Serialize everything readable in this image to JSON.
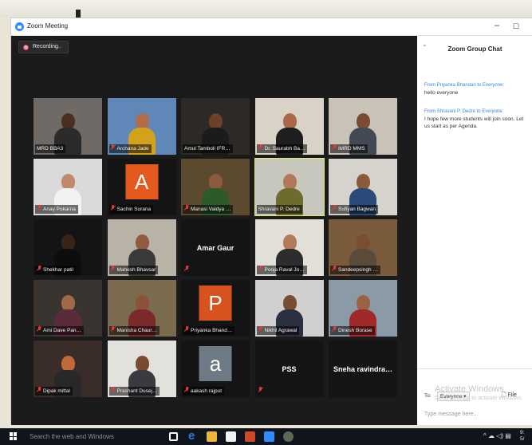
{
  "window": {
    "title": "Zoom Meeting",
    "minimize_glyph": "–",
    "maximize_glyph": "☐"
  },
  "recording": {
    "label": "Recording..",
    "icon": "record-icon"
  },
  "participants": [
    {
      "name": "MRD BBA3",
      "muted": false,
      "kind": "video",
      "bg": "#6f6a66",
      "skin": "#4a2e22",
      "shirt": "#2b2b2b"
    },
    {
      "name": "Archana Jade",
      "muted": true,
      "kind": "video",
      "bg": "#5f87b8",
      "skin": "#b06d4b",
      "shirt": "#d4a21a"
    },
    {
      "name": "Amul Tamboli IFR…",
      "muted": false,
      "kind": "video",
      "bg": "#2c2926",
      "skin": "#6b4228",
      "shirt": "#1b1b1b"
    },
    {
      "name": "Dr. Saurabh Ba…",
      "muted": true,
      "kind": "video",
      "bg": "#d8d2c7",
      "skin": "#a86a48",
      "shirt": "#1e1e1e"
    },
    {
      "name": "IMRD MMS",
      "muted": true,
      "kind": "video",
      "bg": "#c9c2b7",
      "skin": "#7a4c35",
      "shirt": "#444a55"
    },
    {
      "name": "Anay Pokarna",
      "muted": true,
      "kind": "video",
      "bg": "#d9d9d9",
      "skin": "#c08a6a",
      "shirt": "#f2f2f2"
    },
    {
      "name": "Sachin Surana",
      "muted": true,
      "kind": "avatar",
      "letter": "A",
      "color": "#e4591e"
    },
    {
      "name": "Manasi Vaidya …",
      "muted": true,
      "kind": "video",
      "bg": "#5b4a2e",
      "skin": "#8c5a3c",
      "shirt": "#2c5a2a"
    },
    {
      "name": "Shravani P. Dedre",
      "muted": false,
      "active": true,
      "kind": "video",
      "bg": "#c8c7bd",
      "skin": "#b07a5a",
      "shirt": "#6d6b2d"
    },
    {
      "name": "Sufiyan Bagwan",
      "muted": true,
      "kind": "video",
      "bg": "#d6d3cc",
      "skin": "#8a5a3a",
      "shirt": "#2a4a7a"
    },
    {
      "name": "Shekhar patil",
      "muted": true,
      "kind": "video",
      "bg": "#141414",
      "skin": "#3a2418",
      "shirt": "#0d0d0d"
    },
    {
      "name": "Mahesh Bhavsar",
      "muted": true,
      "kind": "video",
      "bg": "#b9b2a6",
      "skin": "#8e5c3e",
      "shirt": "#3a3a3a"
    },
    {
      "name": "",
      "muted": true,
      "kind": "name",
      "label": "Amar Gaur"
    },
    {
      "name": "Pooja Raval Jo…",
      "muted": true,
      "kind": "video",
      "bg": "#e1dfd8",
      "skin": "#b17a58",
      "shirt": "#2d2d2d"
    },
    {
      "name": "Sandeepsingh …",
      "muted": true,
      "kind": "video",
      "bg": "#7a5b3c",
      "skin": "#7a4e30",
      "shirt": "#5a4b3a"
    },
    {
      "name": "Ami Dave Pan…",
      "muted": true,
      "kind": "video",
      "bg": "#3a3431",
      "skin": "#a26948",
      "shirt": "#5a2c3a"
    },
    {
      "name": "Manisha Chaur…",
      "muted": true,
      "kind": "video",
      "bg": "#7a6a4e",
      "skin": "#8a5236",
      "shirt": "#7a2a2a"
    },
    {
      "name": "Priyanka Bhand…",
      "muted": true,
      "kind": "avatar",
      "letter": "P",
      "color": "#d9531e"
    },
    {
      "name": "Nikhil Agrawal",
      "muted": true,
      "kind": "video",
      "bg": "#cfd0cf",
      "skin": "#7a4c32",
      "shirt": "#2a3040"
    },
    {
      "name": "Dinesh Borase",
      "muted": true,
      "kind": "video",
      "bg": "#8a9aa6",
      "skin": "#9a6444",
      "shirt": "#a02a2a"
    },
    {
      "name": "Dipak mittal",
      "muted": true,
      "kind": "video",
      "bg": "#3a2c28",
      "skin": "#c06a3a",
      "shirt": "#282828"
    },
    {
      "name": "Prashant Dusej…",
      "muted": true,
      "kind": "video",
      "bg": "#e3e1dc",
      "skin": "#7a4a30",
      "shirt": "#3a3a40"
    },
    {
      "name": "aakash rajput",
      "muted": true,
      "kind": "avatar",
      "letter": "a",
      "color": "#6e7a85"
    },
    {
      "name": "",
      "muted": true,
      "kind": "name",
      "label": "PSS"
    },
    {
      "name": "",
      "muted": false,
      "kind": "name",
      "label": "Sneha  ravindra…"
    }
  ],
  "chat": {
    "title": "Zoom Group Chat",
    "collapse_glyph": "⌄",
    "messages": [
      {
        "from": "Priyanka Bhandari",
        "to": "Everyone",
        "text": "hello everyone"
      },
      {
        "from": "Shravani P. Dedre",
        "to": "Everyone",
        "text": "I hope few more students will join soon. Let us start as per Agenda."
      }
    ],
    "from_word": "From",
    "to_word": "to",
    "to_label": "To:",
    "to_value": "Everyone ▾",
    "file_label": "File",
    "input_placeholder": "Type message here..."
  },
  "watermark": {
    "line1": "Activate Windows",
    "line2": "Go to Settings to activate Windows."
  },
  "taskbar": {
    "search_placeholder": "Search the web and Windows",
    "tray_text": "^ ☁ ◁) ▤",
    "clock_line1": "9:",
    "clock_line2": "5/"
  }
}
